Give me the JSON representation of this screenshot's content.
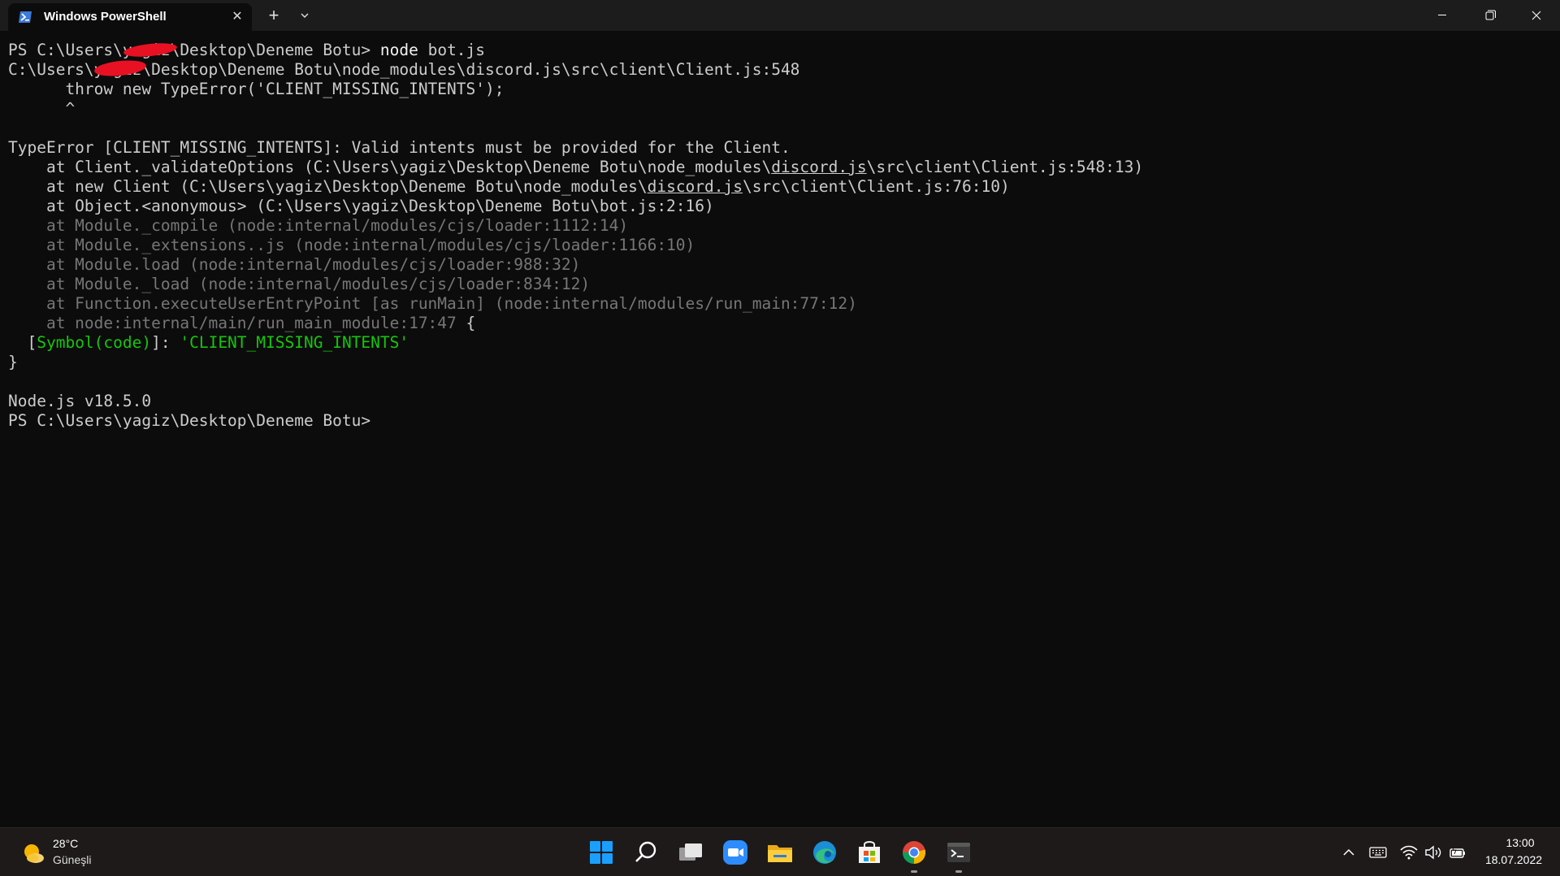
{
  "window": {
    "tab_title": "Windows PowerShell",
    "tab_icon": "powershell-icon",
    "new_tab_icon": "plus-icon",
    "dropdown_icon": "chevron-down-icon",
    "controls": [
      "minimize-icon",
      "restore-icon",
      "close-icon"
    ]
  },
  "terminal": {
    "lines": [
      {
        "segments": [
          {
            "t": "PS C:\\Users\\yagiz\\Desktop\\Deneme Botu> ",
            "c": ""
          },
          {
            "t": "node",
            "c": "bright"
          },
          {
            "t": " bot.js",
            "c": ""
          }
        ]
      },
      {
        "segments": [
          {
            "t": "C:\\Users\\yagiz\\Desktop\\Deneme Botu\\node_modules\\discord.js\\src\\client\\Client.js:548",
            "c": ""
          }
        ]
      },
      {
        "segments": [
          {
            "t": "      throw new TypeError('CLIENT_MISSING_INTENTS');",
            "c": ""
          }
        ]
      },
      {
        "segments": [
          {
            "t": "      ^",
            "c": ""
          }
        ]
      },
      {
        "segments": []
      },
      {
        "segments": [
          {
            "t": "TypeError [CLIENT_MISSING_INTENTS]: Valid intents must be provided for the Client.",
            "c": ""
          }
        ]
      },
      {
        "segments": [
          {
            "t": "    at Client._validateOptions (C:\\Users\\yagiz\\Desktop\\Deneme Botu\\node_modules\\",
            "c": ""
          },
          {
            "t": "discord.js",
            "c": "u"
          },
          {
            "t": "\\src\\client\\Client.js:548:13)",
            "c": ""
          }
        ]
      },
      {
        "segments": [
          {
            "t": "    at new Client (C:\\Users\\yagiz\\Desktop\\Deneme Botu\\node_modules\\",
            "c": ""
          },
          {
            "t": "discord.js",
            "c": "u"
          },
          {
            "t": "\\src\\client\\Client.js:76:10)",
            "c": ""
          }
        ]
      },
      {
        "segments": [
          {
            "t": "    at Object.<anonymous> (C:\\Users\\yagiz\\Desktop\\Deneme Botu\\bot.js:2:16)",
            "c": ""
          }
        ]
      },
      {
        "segments": [
          {
            "t": "    at Module._compile (node:internal/modules/cjs/loader:1112:14)",
            "c": "dim"
          }
        ]
      },
      {
        "segments": [
          {
            "t": "    at Module._extensions..js (node:internal/modules/cjs/loader:1166:10)",
            "c": "dim"
          }
        ]
      },
      {
        "segments": [
          {
            "t": "    at Module.load (node:internal/modules/cjs/loader:988:32)",
            "c": "dim"
          }
        ]
      },
      {
        "segments": [
          {
            "t": "    at Module._load (node:internal/modules/cjs/loader:834:12)",
            "c": "dim"
          }
        ]
      },
      {
        "segments": [
          {
            "t": "    at Function.executeUserEntryPoint [as runMain] (node:internal/modules/run_main:77:12)",
            "c": "dim"
          }
        ]
      },
      {
        "segments": [
          {
            "t": "    at node:internal/main/run_main_module:17:47",
            "c": "dim"
          },
          {
            "t": " {",
            "c": ""
          }
        ]
      },
      {
        "segments": [
          {
            "t": "  [",
            "c": ""
          },
          {
            "t": "Symbol(code)",
            "c": "green"
          },
          {
            "t": "]: ",
            "c": ""
          },
          {
            "t": "'CLIENT_MISSING_INTENTS'",
            "c": "green"
          }
        ]
      },
      {
        "segments": [
          {
            "t": "}",
            "c": ""
          }
        ]
      },
      {
        "segments": []
      },
      {
        "segments": [
          {
            "t": "Node.js v18.5.0",
            "c": ""
          }
        ]
      },
      {
        "segments": [
          {
            "t": "PS C:\\Users\\yagiz\\Desktop\\Deneme Botu>",
            "c": ""
          }
        ]
      }
    ]
  },
  "taskbar": {
    "weather": {
      "temp": "28°C",
      "condition": "Güneşli",
      "icon": "partly-sunny-icon"
    },
    "apps": [
      {
        "name": "start-button",
        "icon": "windows-logo-icon"
      },
      {
        "name": "search-button",
        "icon": "search-icon"
      },
      {
        "name": "task-view-button",
        "icon": "task-view-icon"
      },
      {
        "name": "zoom-app",
        "icon": "zoom-icon"
      },
      {
        "name": "file-explorer-app",
        "icon": "folder-icon"
      },
      {
        "name": "edge-app",
        "icon": "edge-icon"
      },
      {
        "name": "store-app",
        "icon": "store-icon"
      },
      {
        "name": "chrome-app",
        "icon": "chrome-icon"
      },
      {
        "name": "terminal-app",
        "icon": "terminal-icon"
      }
    ],
    "tray_icons": [
      "chevron-up-icon",
      "keyboard-icon",
      "wifi-icon",
      "volume-icon",
      "battery-icon"
    ],
    "clock": {
      "time": "13:00",
      "date": "18.07.2022"
    }
  },
  "colors": {
    "terminal_bg": "#0c0c0c",
    "text": "#cccccc",
    "dim_text": "#767676",
    "green": "#16c60c",
    "redaction": "#e81123"
  }
}
